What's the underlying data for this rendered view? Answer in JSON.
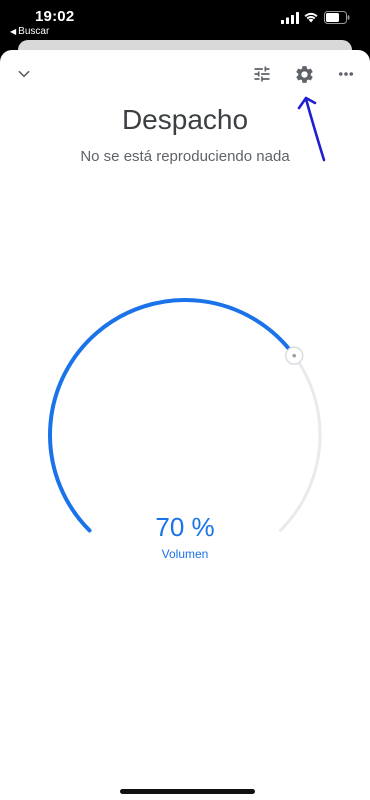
{
  "status_bar": {
    "time": "19:02",
    "back_label": "Buscar"
  },
  "toolbar": {
    "collapse_icon": "chevron-down-icon",
    "eq_icon": "tune-icon",
    "settings_icon": "gear-icon",
    "more_icon": "more-horiz-icon"
  },
  "device": {
    "name": "Despacho",
    "status": "No se está reproduciendo nada"
  },
  "volume": {
    "level": 0.7,
    "display": "70 %",
    "label": "Volumen"
  },
  "colors": {
    "accent": "#1a73e8",
    "track": "#e8eaed",
    "annotation": "#1f1fd0"
  }
}
